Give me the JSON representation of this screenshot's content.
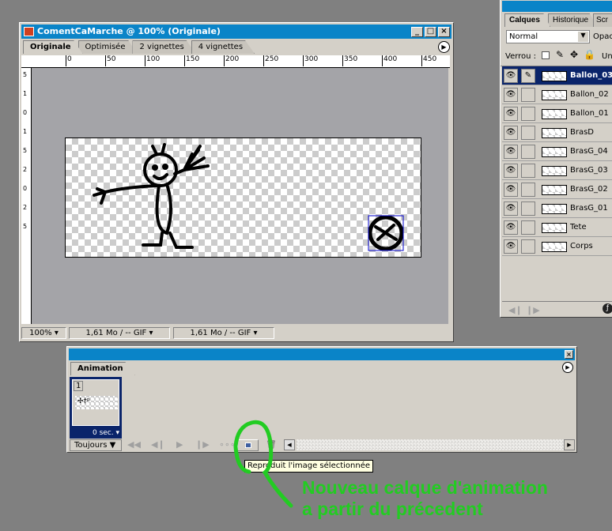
{
  "document": {
    "title": "ComentCaMarche @ 100% (Originale)",
    "tabs": [
      "Originale",
      "Optimisée",
      "2 vignettes",
      "4 vignettes"
    ],
    "ruler_ticks": [
      "0",
      "50",
      "100",
      "150",
      "200",
      "250",
      "300",
      "350",
      "400",
      "450"
    ],
    "vruler_ticks": [
      "5",
      "1",
      "0",
      "1",
      "5",
      "2",
      "0",
      "2",
      "5"
    ],
    "status": {
      "zoom": "100%",
      "size1": "1,61 Mo / -- GIF",
      "size2": "1,61 Mo / -- GIF"
    }
  },
  "layers_panel": {
    "tabs": [
      "Calques",
      "Historique",
      "Scr"
    ],
    "blend_mode": "Normal",
    "opacity_label": "Opac",
    "lock_label": "Verrou :",
    "unify_label": "Un",
    "layers": [
      {
        "name": "Ballon_03",
        "selected": true
      },
      {
        "name": "Ballon_02"
      },
      {
        "name": "Ballon_01"
      },
      {
        "name": "BrasD"
      },
      {
        "name": "BrasG_04"
      },
      {
        "name": "BrasG_03"
      },
      {
        "name": "BrasG_02"
      },
      {
        "name": "BrasG_01"
      },
      {
        "name": "Tete"
      },
      {
        "name": "Corps"
      }
    ]
  },
  "animation": {
    "tab": "Animation",
    "frames": [
      {
        "number": "1",
        "delay": "0 sec."
      }
    ],
    "loop": "Toujours",
    "tooltip": "Reproduit l'image sélectionnée"
  },
  "annotation": {
    "line1": "Nouveau calque d'animation",
    "line2": "a partir du précedent",
    "color": "#22cc22"
  },
  "colors": {
    "title_bar": "#0a84c8",
    "selection": "#0a246a"
  }
}
